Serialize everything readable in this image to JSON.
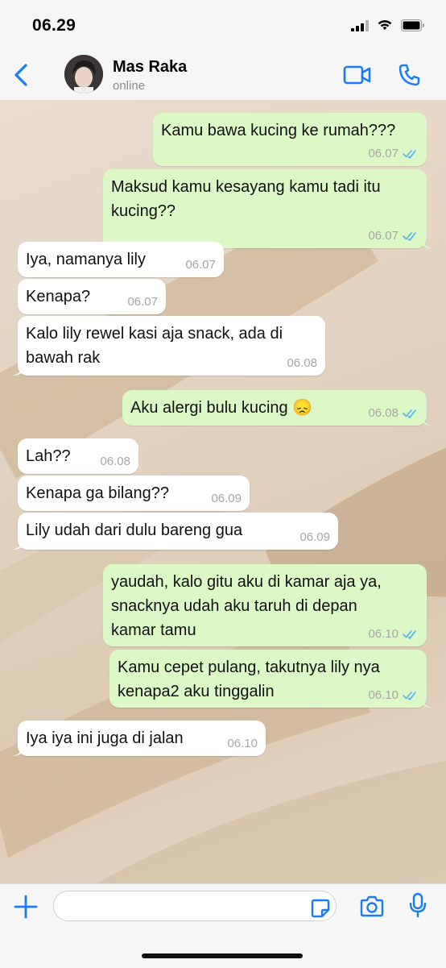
{
  "status_bar": {
    "time": "06.29"
  },
  "header": {
    "name": "Mas Raka",
    "status": "online",
    "colors": {
      "accent": "#1a7cf4"
    },
    "icons": [
      "chevron-left-icon",
      "video-camera-icon",
      "phone-icon"
    ]
  },
  "messages": [
    {
      "dir": "out",
      "lines": [
        "Kamu bawa kucing ke rumah???"
      ],
      "time": "06.07",
      "read": true
    },
    {
      "dir": "out",
      "lines": [
        "Maksud kamu kesayang kamu tadi itu",
        "kucing??"
      ],
      "time": "06.07",
      "read": true
    },
    {
      "dir": "in",
      "lines": [
        "Iya, namanya lily"
      ],
      "time": "06.07"
    },
    {
      "dir": "in",
      "lines": [
        "Kenapa?"
      ],
      "time": "06.07"
    },
    {
      "dir": "in",
      "lines": [
        "Kalo lily rewel kasi aja snack, ada di",
        "bawah rak"
      ],
      "time": "06.08"
    },
    {
      "dir": "out",
      "lines": [
        "Aku alergi bulu kucing 😞"
      ],
      "time": "06.08",
      "read": true
    },
    {
      "dir": "in",
      "lines": [
        "Lah??"
      ],
      "time": "06.08"
    },
    {
      "dir": "in",
      "lines": [
        "Kenapa ga bilang??"
      ],
      "time": "06.09"
    },
    {
      "dir": "in",
      "lines": [
        "Lily udah dari dulu bareng gua"
      ],
      "time": "06.09"
    },
    {
      "dir": "out",
      "lines": [
        "yaudah, kalo gitu aku di kamar aja ya,",
        "snacknya udah aku taruh di depan",
        "kamar tamu"
      ],
      "time": "06.10",
      "read": true
    },
    {
      "dir": "out",
      "lines": [
        "Kamu cepet pulang, takutnya lily nya",
        "kenapa2 aku tinggalin"
      ],
      "time": "06.10",
      "read": true
    },
    {
      "dir": "in",
      "lines": [
        "Iya iya ini juga di jalan"
      ],
      "time": "06.10"
    }
  ],
  "colors": {
    "bubble_out": "#dcf8c6",
    "bubble_in": "#ffffff",
    "read_ticks": "#4fb3f0"
  },
  "input_bar": {
    "placeholder": "",
    "icons": [
      "plus-icon",
      "sticker-icon",
      "camera-icon",
      "microphone-icon"
    ]
  }
}
